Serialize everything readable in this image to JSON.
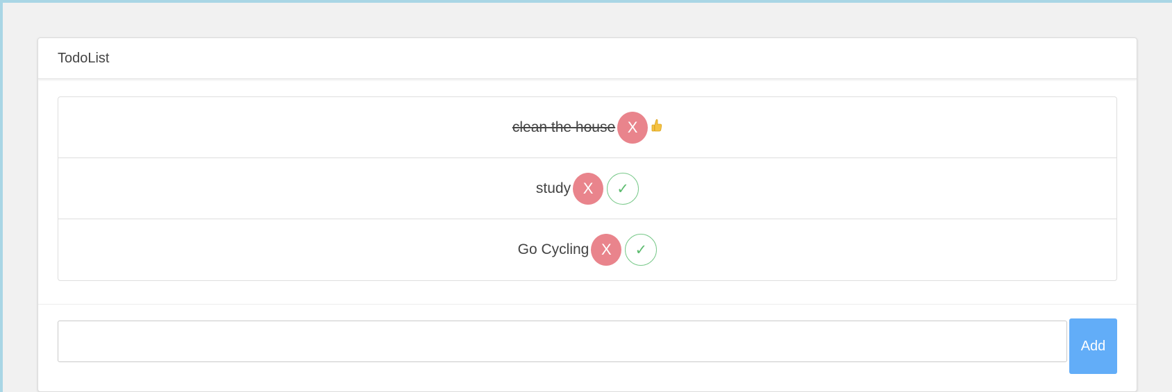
{
  "panel": {
    "title": "TodoList"
  },
  "todos": [
    {
      "text": "clean the house",
      "done": true,
      "delete_label": "X",
      "status_icon": "thumbs-up-icon"
    },
    {
      "text": "study",
      "done": false,
      "delete_label": "X",
      "check_label": "✓",
      "status_icon": "check-icon"
    },
    {
      "text": "Go Cycling",
      "done": false,
      "delete_label": "X",
      "check_label": "✓",
      "status_icon": "check-icon"
    }
  ],
  "new_todo": {
    "value": "",
    "placeholder": "",
    "add_label": "Add"
  },
  "colors": {
    "delete": "#e9848c",
    "check": "#5cbb6e",
    "add": "#62adf8",
    "thumb": "#f5c242"
  }
}
